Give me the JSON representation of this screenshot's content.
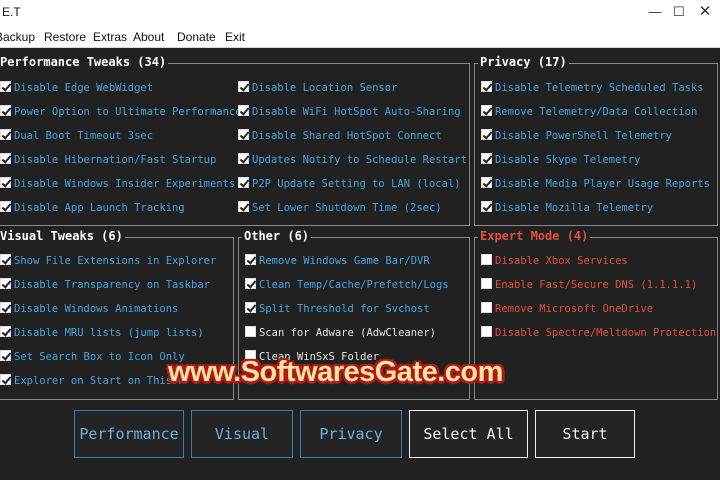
{
  "window": {
    "title": "E.T",
    "minimize": "—",
    "maximize": "☐",
    "close": "✕"
  },
  "menu": [
    "Backup",
    "Restore",
    "Extras",
    "About",
    "Donate",
    "Exit"
  ],
  "groups": {
    "performance": {
      "title": "Performance Tweaks (34)",
      "col1": [
        {
          "label": "Disable Edge WebWidget",
          "checked": true
        },
        {
          "label": "Power Option to Ultimate Performance",
          "checked": true
        },
        {
          "label": "Dual Boot Timeout 3sec",
          "checked": true
        },
        {
          "label": "Disable Hibernation/Fast Startup",
          "checked": true
        },
        {
          "label": "Disable Windows Insider Experiments",
          "checked": true
        },
        {
          "label": "Disable App Launch Tracking",
          "checked": true
        }
      ],
      "col2": [
        {
          "label": "Disable Location Sensor",
          "checked": true
        },
        {
          "label": "Disable WiFi HotSpot Auto-Sharing",
          "checked": true
        },
        {
          "label": "Disable Shared HotSpot Connect",
          "checked": true
        },
        {
          "label": "Updates Notify to Schedule Restart",
          "checked": true
        },
        {
          "label": "P2P Update Setting to LAN (local)",
          "checked": true
        },
        {
          "label": "Set Lower Shutdown Time (2sec)",
          "checked": true
        }
      ]
    },
    "privacy": {
      "title": "Privacy (17)",
      "items": [
        {
          "label": "Disable Telemetry Scheduled Tasks",
          "checked": true
        },
        {
          "label": "Remove Telemetry/Data Collection",
          "checked": true
        },
        {
          "label": "Disable PowerShell Telemetry",
          "checked": true
        },
        {
          "label": "Disable Skype Telemetry",
          "checked": true
        },
        {
          "label": "Disable Media Player Usage Reports",
          "checked": true
        },
        {
          "label": "Disable Mozilla Telemetry",
          "checked": true
        }
      ]
    },
    "visual": {
      "title": "Visual Tweaks (6)",
      "items": [
        {
          "label": "Show File Extensions in Explorer",
          "checked": true
        },
        {
          "label": "Disable Transparency on Taskbar",
          "checked": true
        },
        {
          "label": "Disable Windows Animations",
          "checked": true
        },
        {
          "label": "Disable MRU lists (jump lists)",
          "checked": true
        },
        {
          "label": "Set Search Box to Icon Only",
          "checked": true
        },
        {
          "label": "Explorer on Start on This P",
          "checked": true
        }
      ]
    },
    "other": {
      "title": "Other (6)",
      "items": [
        {
          "label": "Remove Windows Game Bar/DVR",
          "checked": true
        },
        {
          "label": "Clean Temp/Cache/Prefetch/Logs",
          "checked": true
        },
        {
          "label": "Split Threshold for Svchost",
          "checked": true
        },
        {
          "label": "Scan for Adware (AdwCleaner)",
          "checked": false
        },
        {
          "label": "Clean WinSxS Folder",
          "checked": false
        }
      ]
    },
    "expert": {
      "title": "Expert Mode (4)",
      "items": [
        {
          "label": "Disable Xbox Services",
          "checked": false
        },
        {
          "label": "Enable Fast/Secure DNS (1.1.1.1)",
          "checked": false
        },
        {
          "label": "Remove Microsoft OneDrive",
          "checked": false
        },
        {
          "label": "Disable Spectre/Meltdown Protection",
          "checked": false
        }
      ]
    }
  },
  "buttons": {
    "performance": "Performance",
    "visual": "Visual",
    "privacy": "Privacy",
    "select_all": "Select All",
    "start": "Start"
  },
  "watermark": "www.SoftwaresGate.com",
  "colors": {
    "accent_blue": "#4aa3df",
    "expert_red": "#e0503f",
    "background": "#212121"
  }
}
